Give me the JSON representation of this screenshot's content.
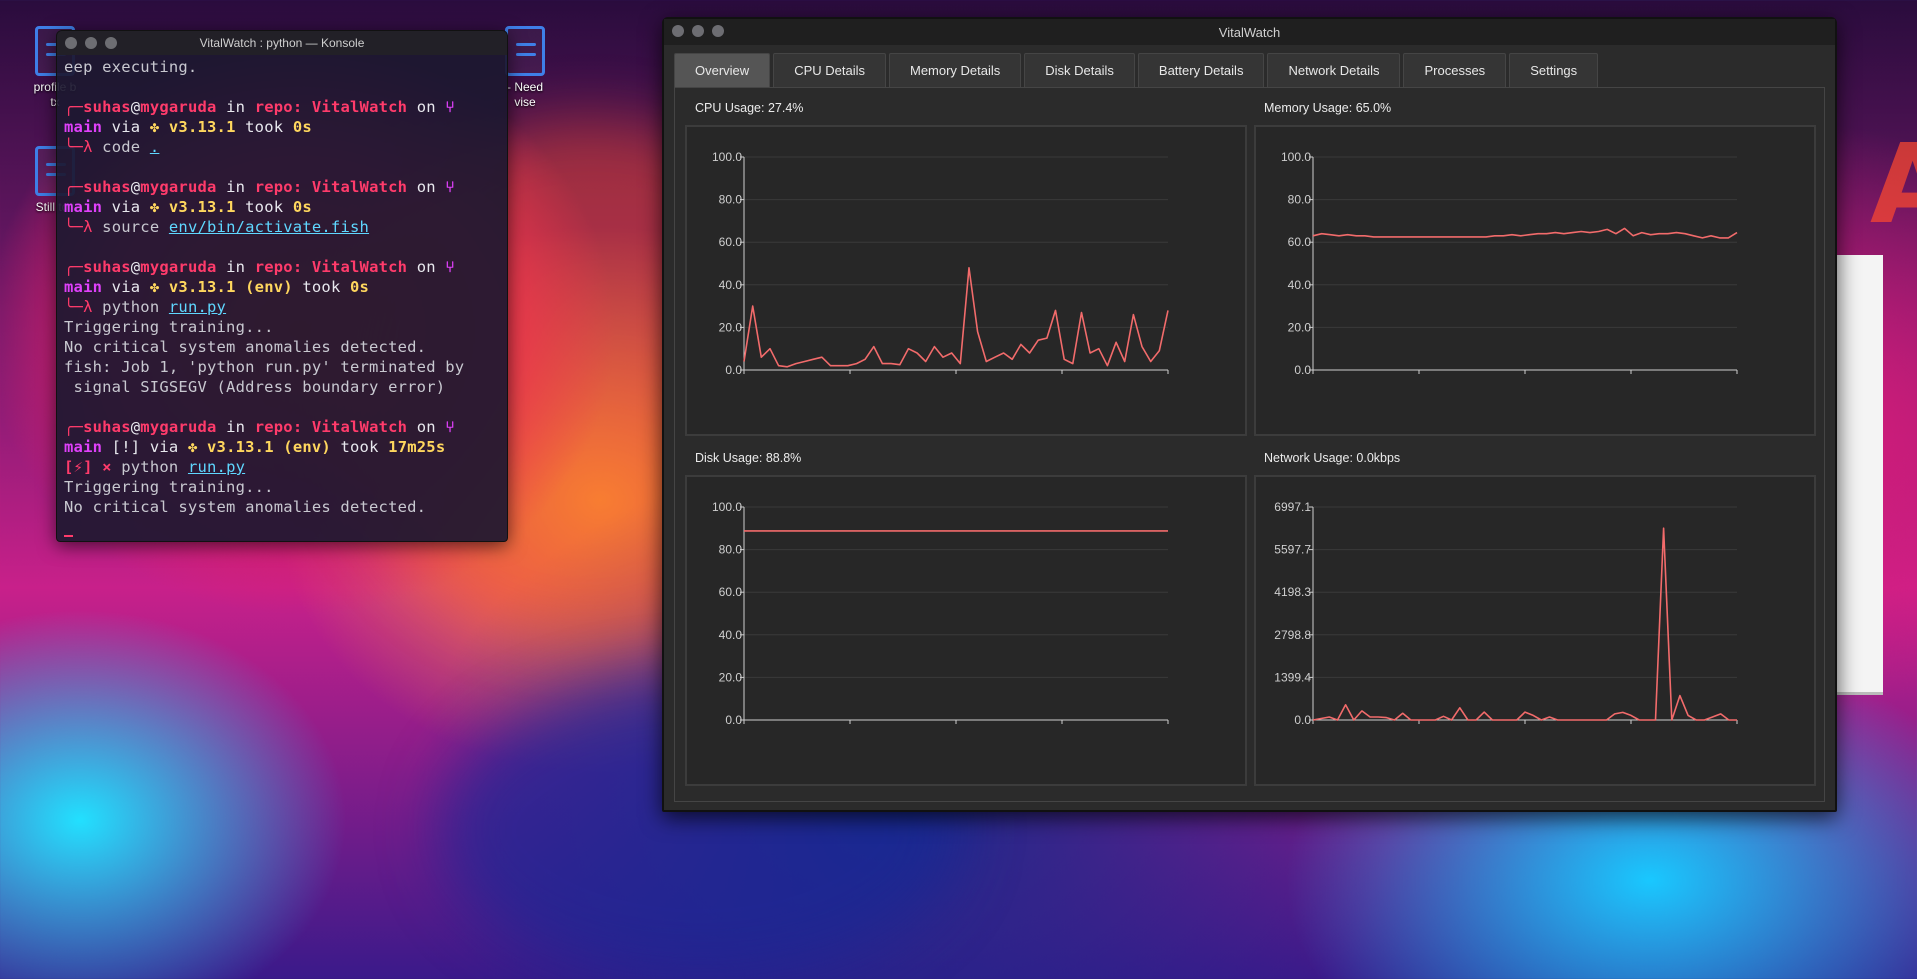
{
  "desktop": {
    "icons": [
      {
        "label": "profile b\ntx"
      },
      {
        "label": "Still to l"
      },
      {
        "label": "- Need\nvise"
      }
    ]
  },
  "konsole": {
    "title": "VitalWatch : python — Konsole",
    "lines": [
      "eep executing."
    ],
    "prompt": {
      "user": "suhas",
      "at": "@",
      "host": "mygaruda",
      "in": " in ",
      "repo": "repo: VitalWatch",
      "on": " on ",
      "branch_icon": "⑂",
      "branch": "main",
      "via": " via ",
      "py_icon": "✤",
      "py": "v3.13.1",
      "env": "(env)",
      "took": " took ",
      "lambda": "λ"
    },
    "commands": [
      {
        "took": "0s",
        "cmd": "code",
        "arg": "."
      },
      {
        "took": "0s",
        "cmd": "source",
        "arg": "env/bin/activate.fish"
      },
      {
        "took": "0s",
        "cmd": "python",
        "arg": "run.py"
      },
      {
        "took": "17m25s",
        "cmd": "python",
        "arg": "run.py"
      }
    ],
    "output1": [
      "Triggering training...",
      "No critical system anomalies detected.",
      "fish: Job 1, 'python run.py' terminated by",
      " signal SIGSEGV (Address boundary error)"
    ],
    "status_marker": "[!]",
    "bolt": "[⚡]",
    "x_mark": "×",
    "output2": [
      "Triggering training...",
      "No critical system anomalies detected."
    ]
  },
  "vitalwatch": {
    "title": "VitalWatch",
    "tabs": [
      "Overview",
      "CPU Details",
      "Memory Details",
      "Disk Details",
      "Battery Details",
      "Network Details",
      "Processes",
      "Settings"
    ],
    "active_tab": "Overview",
    "line_color": "#f26b6b",
    "charts_labels": {
      "cpu": "CPU Usage: 27.4%",
      "memory": "Memory Usage: 65.0%",
      "disk": "Disk Usage: 88.8%",
      "network": "Network Usage: 0.0kbps"
    }
  },
  "chart_data": [
    {
      "type": "line",
      "title": "CPU Usage: 27.4%",
      "ylim": [
        0,
        100
      ],
      "yticks": [
        "0.0",
        "20.0",
        "40.0",
        "60.0",
        "80.0",
        "100.0"
      ],
      "values": [
        4,
        30,
        6,
        10,
        2,
        1.5,
        3,
        4,
        5,
        6,
        2,
        2,
        2,
        3,
        5,
        11,
        3,
        3,
        2.5,
        10,
        8,
        4,
        11,
        6,
        8,
        3,
        48,
        18,
        4,
        6,
        8,
        5,
        12,
        8,
        14,
        15,
        28,
        5,
        3,
        27,
        8,
        10,
        2,
        13,
        4,
        26,
        11,
        4,
        9,
        28
      ]
    },
    {
      "type": "line",
      "title": "Memory Usage: 65.0%",
      "ylim": [
        0,
        100
      ],
      "yticks": [
        "0.0",
        "20.0",
        "40.0",
        "60.0",
        "80.0",
        "100.0"
      ],
      "values": [
        63,
        64,
        63.5,
        63,
        63.5,
        63,
        63,
        62.5,
        62.5,
        62.5,
        62.5,
        62.5,
        62.5,
        62.5,
        62.5,
        62.5,
        62.5,
        62.5,
        62.5,
        62.5,
        62.5,
        63,
        63,
        63.5,
        63,
        63.5,
        64,
        64,
        64.5,
        64,
        64.5,
        65,
        64.5,
        65,
        66,
        64,
        66.5,
        63,
        64.5,
        63.5,
        64,
        64,
        64.5,
        64,
        63,
        62,
        63,
        62,
        62,
        64.5
      ]
    },
    {
      "type": "line",
      "title": "Disk Usage: 88.8%",
      "ylim": [
        0,
        100
      ],
      "yticks": [
        "0.0",
        "20.0",
        "40.0",
        "60.0",
        "80.0",
        "100.0"
      ],
      "values": [
        88.8,
        88.8,
        88.8,
        88.8,
        88.8,
        88.8,
        88.8,
        88.8,
        88.8,
        88.8,
        88.8,
        88.8,
        88.8,
        88.8,
        88.8,
        88.8,
        88.8,
        88.8,
        88.8,
        88.8,
        88.8,
        88.8,
        88.8,
        88.8,
        88.8,
        88.8,
        88.8,
        88.8,
        88.8,
        88.8,
        88.8,
        88.8,
        88.8,
        88.8,
        88.8,
        88.8,
        88.8,
        88.8,
        88.8,
        88.8
      ]
    },
    {
      "type": "line",
      "title": "Network Usage: 0.0kbps",
      "ylim": [
        0,
        6997.1
      ],
      "yticks": [
        "0.0",
        "1399.4",
        "2798.8",
        "4198.3",
        "5597.7",
        "6997.1"
      ],
      "values": [
        0,
        50,
        100,
        0,
        500,
        0,
        300,
        100,
        100,
        80,
        0,
        220,
        0,
        0,
        0,
        0,
        120,
        0,
        400,
        0,
        0,
        260,
        0,
        0,
        0,
        0,
        260,
        150,
        0,
        100,
        0,
        0,
        0,
        0,
        0,
        0,
        0,
        200,
        250,
        150,
        0,
        0,
        0,
        6300,
        0,
        800,
        150,
        0,
        0,
        100,
        200,
        0,
        0
      ]
    }
  ]
}
